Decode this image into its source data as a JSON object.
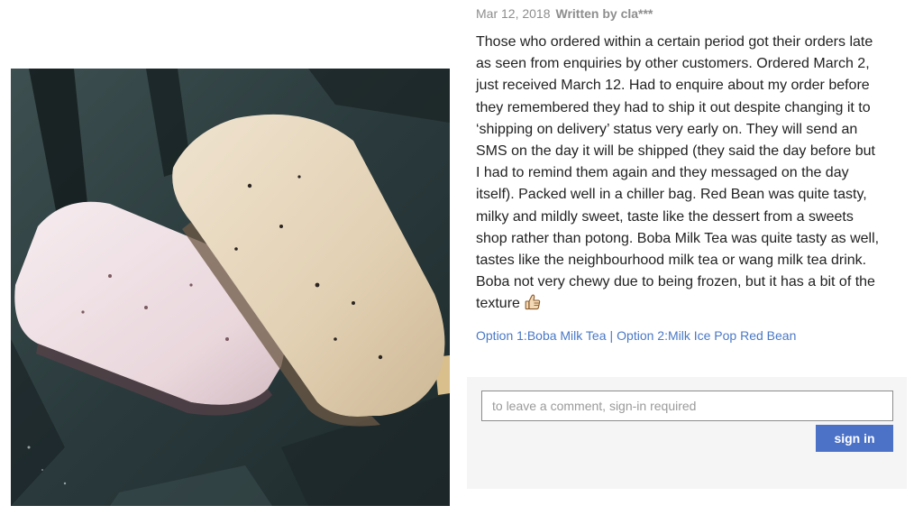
{
  "review": {
    "date": "Mar 12, 2018",
    "author": "Written by cla***",
    "lines": [
      "Those who ordered within a certain period got their orders late",
      "as seen from enquiries by other customers. Ordered March 2,",
      "just received March 12. Had to enquire about my order before",
      "they remembered they had to ship it out despite changing it to",
      "‘shipping on delivery’ status very early on. They will send an",
      "SMS on the day it will be shipped (they said the day before but",
      "I had to remind them again and they messaged on the day",
      "itself). Packed well in a chiller bag. Red Bean was quite tasty,",
      "milky and mildly sweet, taste like the dessert from a sweets",
      "shop rather than potong. Boba Milk Tea was quite tasty as well,",
      "tastes like the neighbourhood milk tea or wang milk tea drink.",
      "Boba not very chewy due to being frozen, but it has a bit of the",
      "texture"
    ],
    "emoji_icon": "thumbs-up-icon",
    "options": [
      "Option 1:Boba Milk Tea",
      "Option 2:Milk Ice Pop Red Bean"
    ],
    "options_separator": "|"
  },
  "comment": {
    "placeholder": "to leave a comment, sign-in required",
    "value": "",
    "signin_label": "sign in"
  },
  "colors": {
    "meta_text": "#8e8e8e",
    "body_text": "#222222",
    "link": "#4a78c5",
    "button": "#4c72c8",
    "panel": "#f5f5f5"
  }
}
